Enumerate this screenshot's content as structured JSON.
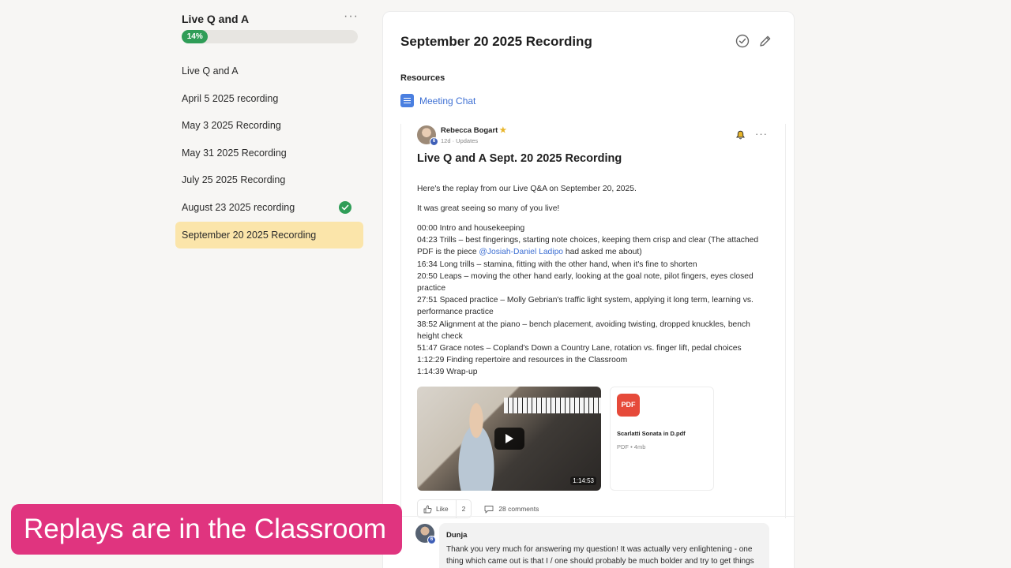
{
  "sidebar": {
    "title": "Live Q and A",
    "more_glyph": "···",
    "progress": {
      "percent": 14,
      "label": "14%"
    },
    "items": [
      {
        "label": "Live Q and A"
      },
      {
        "label": "April 5 2025 recording"
      },
      {
        "label": "May 3 2025 Recording"
      },
      {
        "label": "May 31 2025 Recording"
      },
      {
        "label": "July 25 2025 Recording"
      },
      {
        "label": "August 23 2025 recording",
        "completed": true
      },
      {
        "label": "September 20 2025 Recording",
        "active": true
      }
    ]
  },
  "lesson": {
    "title": "September 20 2025 Recording",
    "resources_label": "Resources",
    "resource_link": "Meeting Chat"
  },
  "post": {
    "author": "Rebecca Bogart",
    "author_badge": "6",
    "meta": "12d · Updates",
    "more_glyph": "···",
    "title": "Live Q and A Sept. 20 2025 Recording",
    "intro": "Here's the replay from our Live Q&A on September 20, 2025.",
    "greeting": "It was great seeing so many of you live!",
    "timestamps": {
      "t1": "00:00 Intro and housekeeping",
      "t2_a": "04:23 Trills – best fingerings, starting note choices, keeping them crisp and clear (The attached PDF is the piece ",
      "t2_mention": "@Josiah-Daniel Ladipo",
      "t2_b": " had asked me about)",
      "t3": "16:34 Long trills – stamina, fitting with the other hand, when it's fine to shorten",
      "t4": "20:50 Leaps – moving the other hand early, looking at the goal note, pilot fingers, eyes closed practice",
      "t5": "27:51 Spaced practice – Molly Gebrian's traffic light system, applying it long term, learning vs. performance practice",
      "t6": "38:52 Alignment at the piano – bench placement, avoiding twisting, dropped knuckles, bench height check",
      "t7": "51:47 Grace notes – Copland's Down a Country Lane, rotation vs. finger lift, pedal choices",
      "t8": "1:12:29 Finding repertoire and resources in the Classroom",
      "t9": "1:14:39 Wrap-up"
    },
    "video": {
      "duration": "1:14:53"
    },
    "attachment": {
      "icon_label": "PDF",
      "name": "Scarlatti Sonata in D.pdf",
      "meta": "PDF • 4mb"
    },
    "like_label": "Like",
    "like_count": "2",
    "comments_label": "28 comments"
  },
  "comment": {
    "author": "Dunja",
    "badge": "6",
    "text": "Thank you very much for answering my question! It was actually very enlightening - one thing which came out is that I / one should probably be much bolder and try to get things"
  },
  "caption": "Replays are in the Classroom",
  "colors": {
    "accent_green": "#2f9d57",
    "active_item": "#fbe5aa",
    "link_blue": "#3d6fd3",
    "caption_pink": "#e0347f",
    "pdf_red": "#e64a3a"
  }
}
